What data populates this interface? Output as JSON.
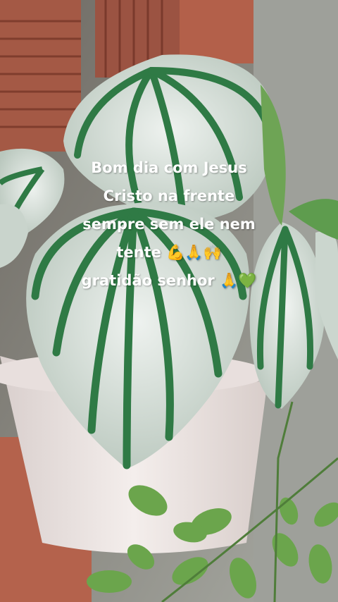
{
  "status_text": {
    "lines": [
      "Bom dia com Jesus",
      "Cristo na frente",
      "sempre sem ele nem",
      "tente 💪🙏🙌",
      "gratidão senhor 🙏💚"
    ]
  },
  "colors": {
    "text": "#ffffff",
    "leaf_silver": "#dfe6e2",
    "leaf_stripe": "#2f7a45",
    "pot": "#efe7e6",
    "wall_tile": "#a45945"
  }
}
